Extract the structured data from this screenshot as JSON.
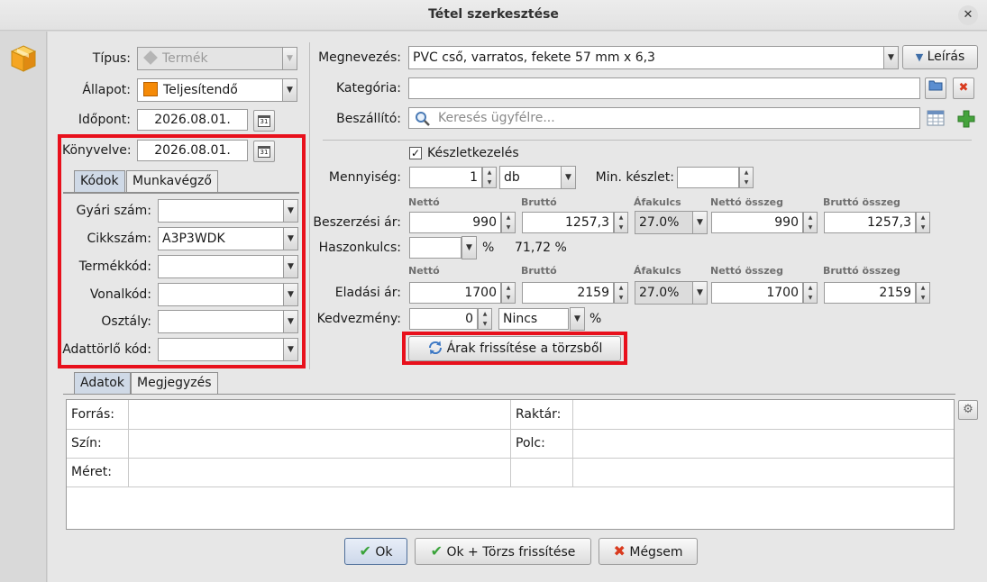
{
  "window": {
    "title": "Tétel szerkesztése"
  },
  "left": {
    "tipus_label": "Típus:",
    "tipus_value": "Termék",
    "allapot_label": "Állapot:",
    "allapot_value": "Teljesítendő",
    "idopont_label": "Időpont:",
    "idopont_value": "2026.08.01.",
    "konyvelve_label": "Könyvelve:",
    "konyvelve_value": "2026.08.01.",
    "calendar_text": "31"
  },
  "code_tabs": [
    {
      "label": "Kódok"
    },
    {
      "label": "Munkavégző"
    }
  ],
  "codes": [
    {
      "label": "Gyári szám:",
      "value": ""
    },
    {
      "label": "Cikkszám:",
      "value": "A3P3WDK"
    },
    {
      "label": "Termékkód:",
      "value": ""
    },
    {
      "label": "Vonalkód:",
      "value": ""
    },
    {
      "label": "Osztály:",
      "value": ""
    },
    {
      "label": "Adattörlő kód:",
      "value": ""
    }
  ],
  "right": {
    "megnevezes_label": "Megnevezés:",
    "megnevezes_value": "PVC cső, varratos, fekete 57 mm x 6,3",
    "leiras_button": "Leírás",
    "kategoria_label": "Kategória:",
    "kategoria_value": "",
    "beszallito_label": "Beszállító:",
    "beszallito_placeholder": "Keresés ügyfélre...",
    "keszletkezeles_label": "Készletkezelés",
    "mennyiseg_label": "Mennyiség:",
    "mennyiseg_value": "1",
    "unit_value": "db",
    "min_keszlet_label": "Min. készlet:",
    "min_keszlet_value": ""
  },
  "price_headers": {
    "netto": "Nettó",
    "brutto": "Bruttó",
    "afakulcs": "Áfakulcs",
    "netto_osszeg": "Nettó összeg",
    "brutto_osszeg": "Bruttó összeg"
  },
  "beszerzesi": {
    "label": "Beszerzési ár:",
    "netto": "990",
    "brutto": "1257,3",
    "afa": "27.0%",
    "netto_osszeg": "990",
    "brutto_osszeg": "1257,3"
  },
  "haszonkulcs": {
    "label": "Haszonkulcs:",
    "value": "",
    "percent_sign": "%",
    "computed": "71,72 %"
  },
  "eladasi": {
    "label": "Eladási ár:",
    "netto": "1700",
    "brutto": "2159",
    "afa": "27.0%",
    "netto_osszeg": "1700",
    "brutto_osszeg": "2159"
  },
  "kedvezmeny": {
    "label": "Kedvezmény:",
    "value": "0",
    "type": "Nincs",
    "percent_sign": "%"
  },
  "refresh_button": "Árak frissítése a törzsből",
  "bottom_tabs": [
    {
      "label": "Adatok"
    },
    {
      "label": "Megjegyzés"
    }
  ],
  "data_grid": {
    "rows": [
      {
        "left_label": "Forrás:",
        "left_value": "",
        "right_label": "Raktár:",
        "right_value": ""
      },
      {
        "left_label": "Szín:",
        "left_value": "",
        "right_label": "Polc:",
        "right_value": ""
      },
      {
        "left_label": "Méret:",
        "left_value": "",
        "right_label": "",
        "right_value": ""
      }
    ]
  },
  "footer": {
    "ok": "Ok",
    "ok_torzs": "Ok + Törzs frissítése",
    "megsem": "Mégsem"
  },
  "colors": {
    "highlight_red": "#e8101c",
    "status_orange": "#f58a07",
    "ok_green": "#3aa33a",
    "cancel_red": "#d93a1e"
  }
}
